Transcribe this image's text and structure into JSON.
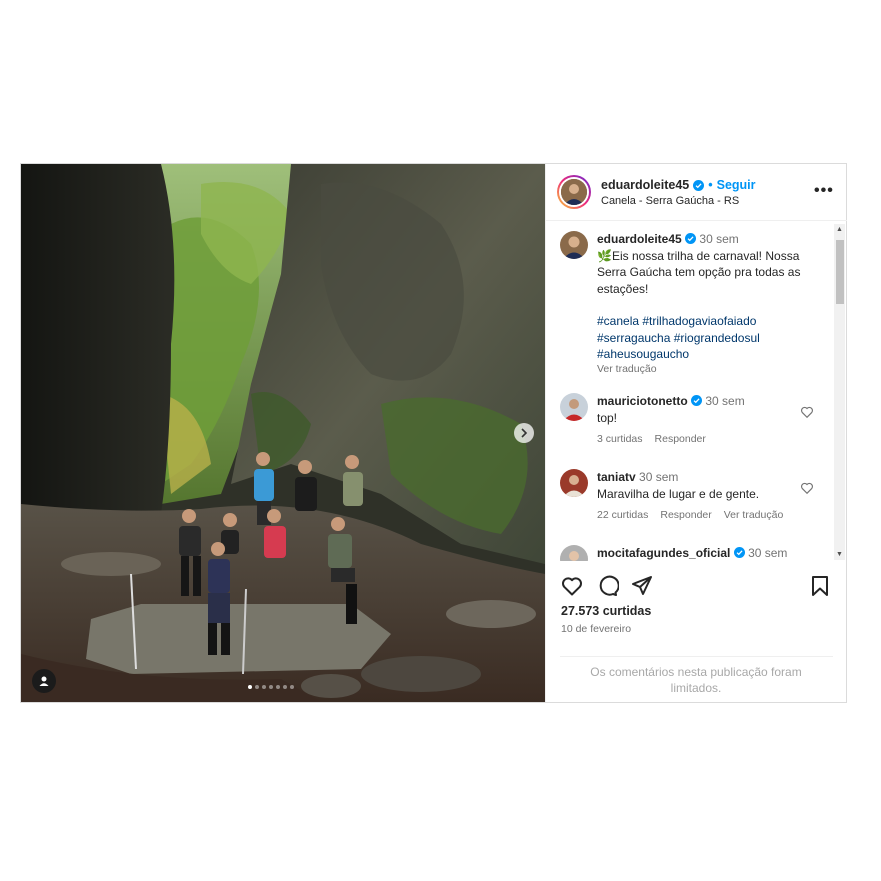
{
  "post": {
    "author": {
      "username": "eduardoleite45",
      "follow_label": "Seguir",
      "separator": "•",
      "location": "Canela - Serra Gaúcha - RS"
    },
    "more_label": "•••",
    "carousel": {
      "slide_count": 7,
      "active_index": 0
    },
    "caption": {
      "username": "eduardoleite45",
      "time": "30 sem",
      "text": "🌿Eis nossa trilha de carnaval! Nossa Serra Gaúcha tem opção pra todas as estações!",
      "hashtags": "#canela #trilhadogaviaofaiado #serragaucha #riograndedosul #aheusougaucho",
      "translate_label": "Ver tradução"
    },
    "comments": [
      {
        "username": "mauriciotonetto",
        "verified": true,
        "time": "30 sem",
        "text": "top!",
        "likes": "3 curtidas",
        "reply": "Responder",
        "translate": ""
      },
      {
        "username": "taniatv",
        "verified": false,
        "time": "30 sem",
        "text": "Maravilha de lugar e de gente.",
        "likes": "22 curtidas",
        "reply": "Responder",
        "translate": "Ver tradução"
      },
      {
        "username": "mocitafagundes_oficial",
        "verified": true,
        "time": "30 sem",
        "text": "",
        "likes": "",
        "reply": "",
        "translate": ""
      }
    ],
    "likes_label": "27.573 curtidas",
    "date_label": "10 de fevereiro",
    "comments_limited": "Os comentários nesta publicação foram limitados.",
    "colors": {
      "accent": "#0095f6",
      "verified": "#0095f6",
      "hashtag": "#00376b",
      "muted": "#737373"
    }
  }
}
